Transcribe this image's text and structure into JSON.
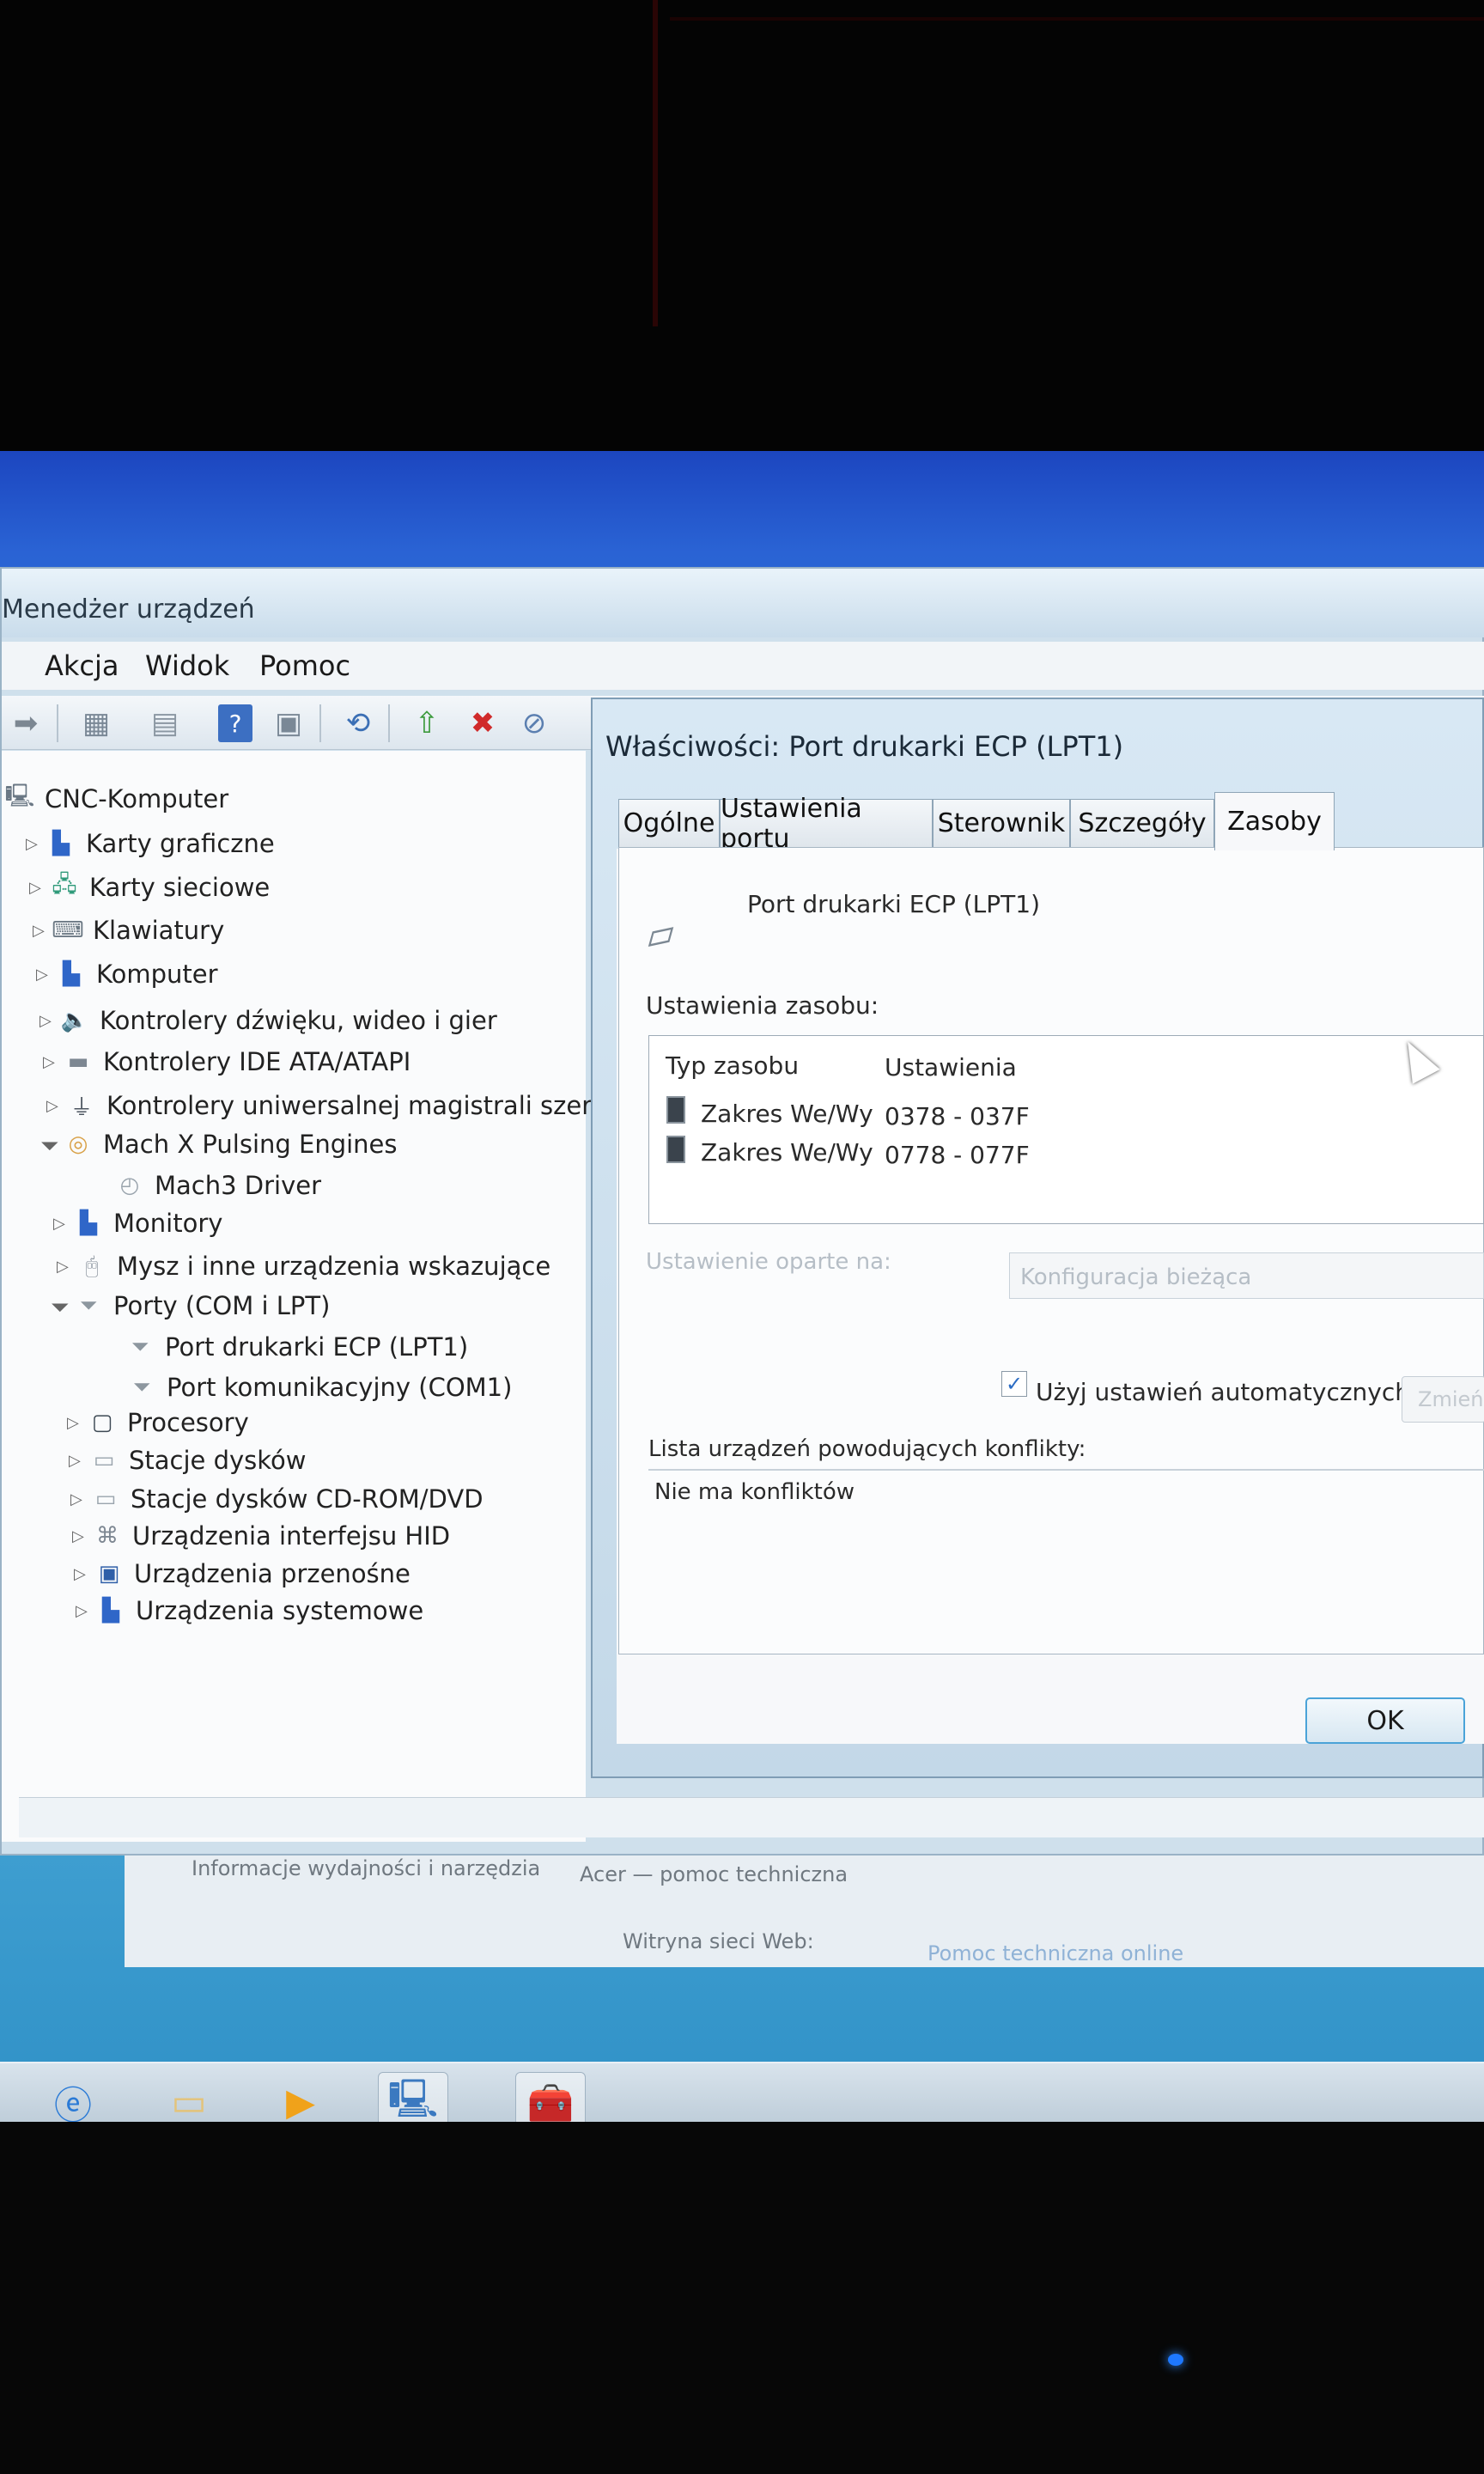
{
  "device_manager": {
    "title": "Menedżer urządzeń",
    "menu": [
      "Akcja",
      "Widok",
      "Pomoc"
    ],
    "tree": {
      "root": "CNC-Komputer",
      "items": [
        {
          "label": "Karty graficzne",
          "icon": "display-adapter-icon"
        },
        {
          "label": "Karty sieciowe",
          "icon": "network-adapter-icon"
        },
        {
          "label": "Klawiatury",
          "icon": "keyboard-icon"
        },
        {
          "label": "Komputer",
          "icon": "computer-icon"
        },
        {
          "label": "Kontrolery dźwięku, wideo i gier",
          "icon": "speaker-icon"
        },
        {
          "label": "Kontrolery IDE ATA/ATAPI",
          "icon": "ide-controller-icon"
        },
        {
          "label": "Kontrolery uniwersalnej magistrali szereg",
          "icon": "usb-icon"
        },
        {
          "label": "Mach  X Pulsing Engines",
          "icon": "mach-icon"
        },
        {
          "label": "Mach3 Driver",
          "icon": "driver-icon"
        },
        {
          "label": "Monitory",
          "icon": "monitor-icon"
        },
        {
          "label": "Mysz i inne urządzenia wskazujące",
          "icon": "mouse-icon"
        },
        {
          "label": "Porty (COM i LPT)",
          "icon": "port-icon"
        },
        {
          "label": "Port drukarki ECP (LPT1)",
          "icon": "port-icon"
        },
        {
          "label": "Port komunikacyjny (COM1)",
          "icon": "port-icon"
        },
        {
          "label": "Procesory",
          "icon": "processor-icon"
        },
        {
          "label": "Stacje dysków",
          "icon": "disk-drive-icon"
        },
        {
          "label": "Stacje dysków CD-ROM/DVD",
          "icon": "cdrom-icon"
        },
        {
          "label": "Urządzenia interfejsu HID",
          "icon": "hid-icon"
        },
        {
          "label": "Urządzenia przenośne",
          "icon": "portable-device-icon"
        },
        {
          "label": "Urządzenia systemowe",
          "icon": "system-device-icon"
        }
      ]
    }
  },
  "dialog": {
    "title": "Właściwości: Port drukarki ECP (LPT1)",
    "tabs": [
      "Ogólne",
      "Ustawienia portu",
      "Sterownik",
      "Szczegóły",
      "Zasoby"
    ],
    "selected_tab": "Zasoby",
    "device_name": "Port drukarki ECP (LPT1)",
    "resource_settings_label": "Ustawienia zasobu:",
    "columns": [
      "Typ zasobu",
      "Ustawienia"
    ],
    "resources": [
      {
        "type": "Zakres We/Wy",
        "setting": "0378 - 037F"
      },
      {
        "type": "Zakres We/Wy",
        "setting": "0778 - 077F"
      }
    ],
    "setting_based_on_label": "Ustawienie oparte na:",
    "setting_based_on_value": "Konfiguracja bieżąca",
    "auto_settings_label": "Użyj ustawień automatycznych",
    "auto_settings_checked": true,
    "change_button": "Zmień",
    "conflict_label": "Lista urządzeń powodujących konflikty:",
    "conflict_value": "Nie ma konfliktów",
    "ok_button": "OK"
  },
  "behind": {
    "left_text": "Informacje wydajności i narzędzia",
    "middle_text": "Acer — pomoc techniczna",
    "website_label": "Witryna sieci Web:",
    "website_link": "Pomoc techniczna online"
  },
  "colors": {
    "accent": "#4aa3d8",
    "desktop": "#3f8fe0",
    "link": "#3a7ed0"
  }
}
